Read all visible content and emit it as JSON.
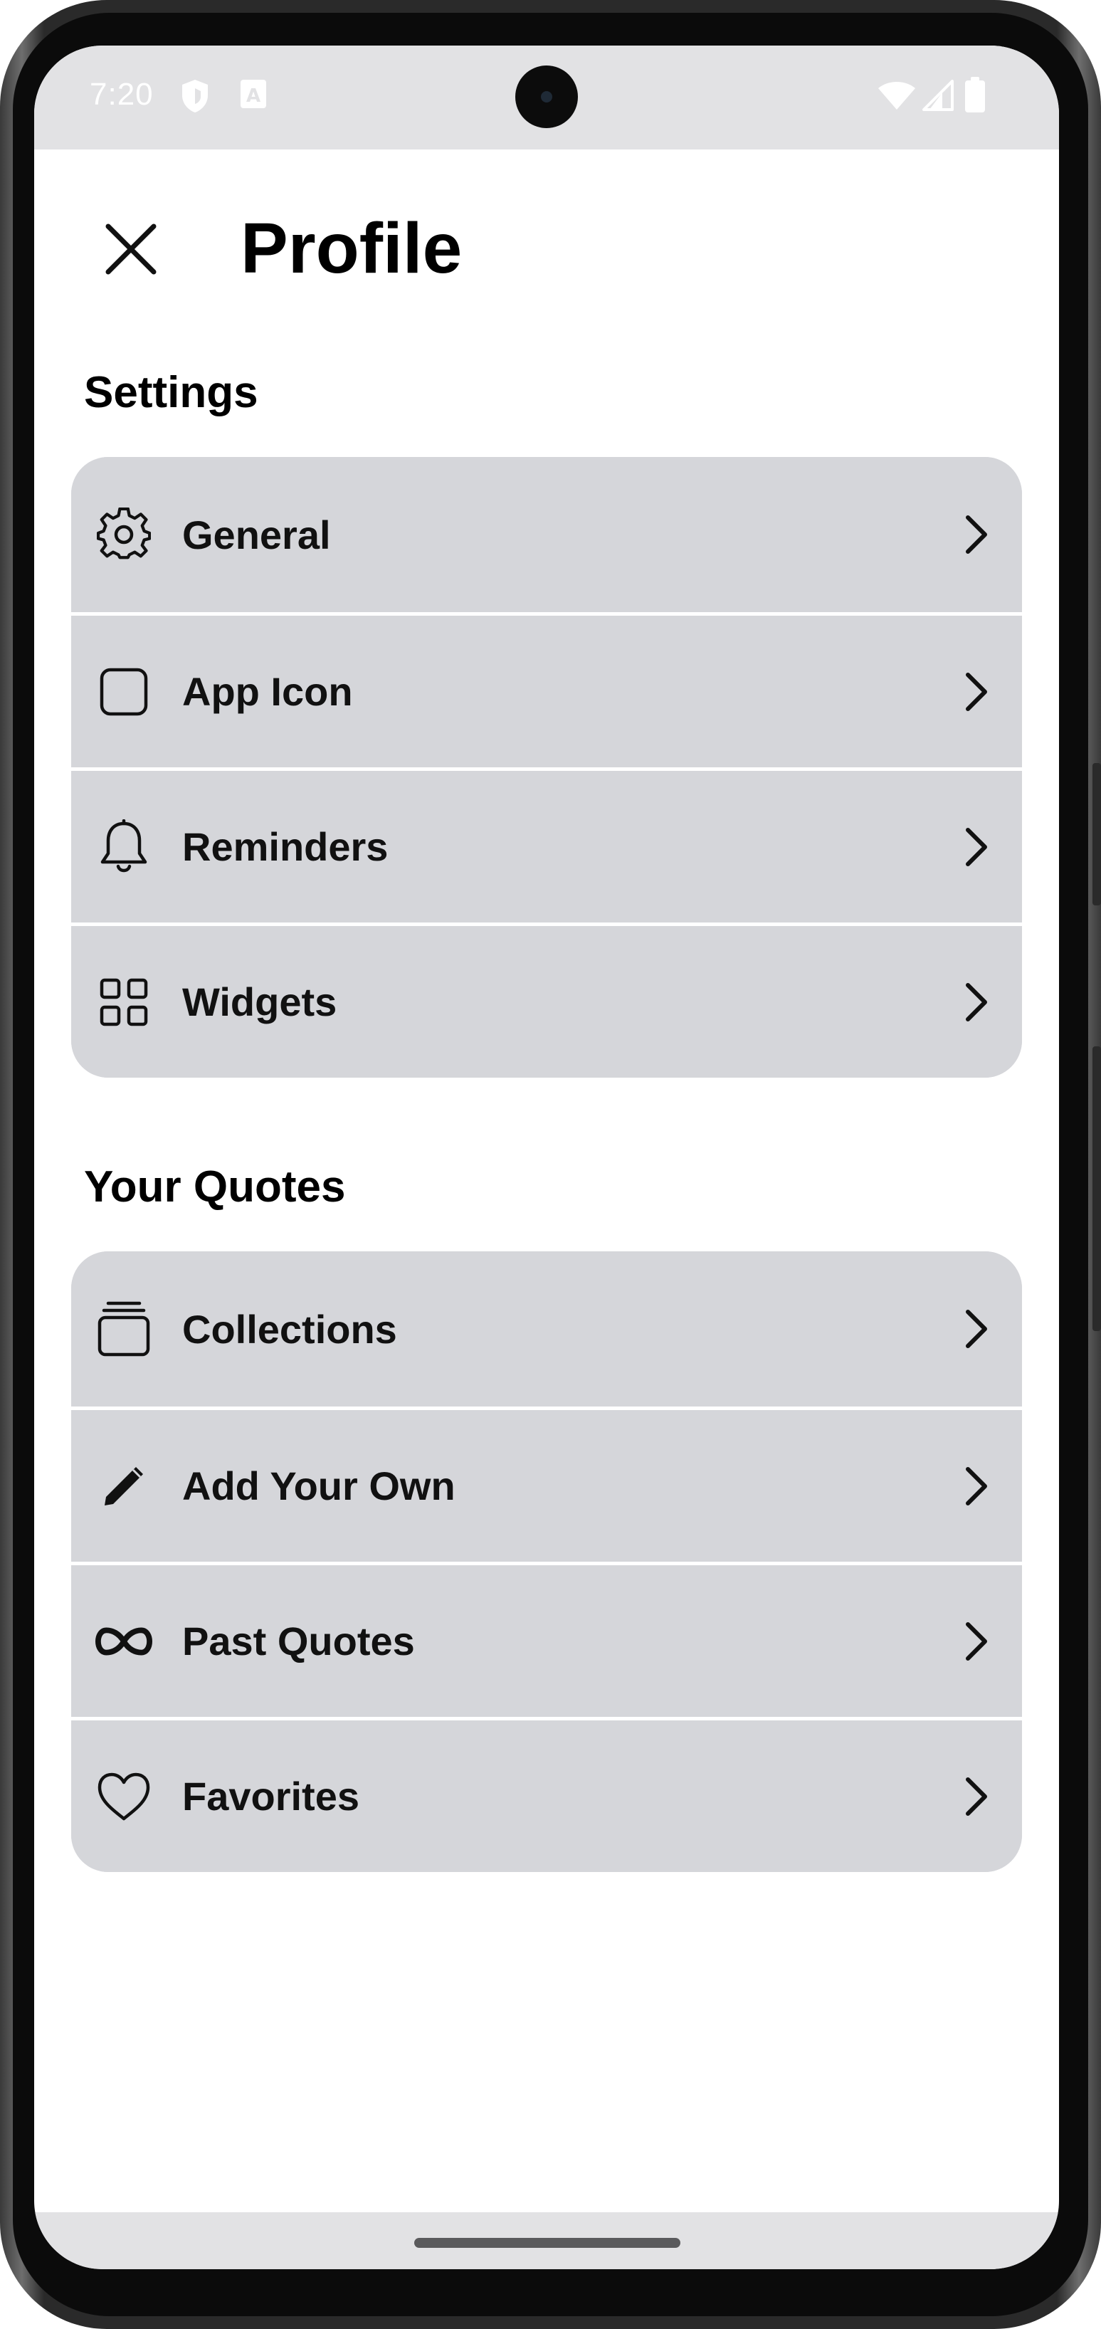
{
  "status_bar": {
    "time": "7:20",
    "icons": [
      "shield-icon",
      "a-box-icon",
      "wifi-icon",
      "cellular-icon",
      "battery-icon"
    ]
  },
  "header": {
    "title": "Profile",
    "close_icon": "close-icon"
  },
  "settings": {
    "title": "Settings",
    "items": [
      {
        "label": "General",
        "icon": "gear-icon"
      },
      {
        "label": "App Icon",
        "icon": "square-icon"
      },
      {
        "label": "Reminders",
        "icon": "bell-icon"
      },
      {
        "label": "Widgets",
        "icon": "grid-icon"
      }
    ]
  },
  "quotes": {
    "title": "Your Quotes",
    "items": [
      {
        "label": "Collections",
        "icon": "stack-icon"
      },
      {
        "label": "Add Your Own",
        "icon": "pencil-icon"
      },
      {
        "label": "Past Quotes",
        "icon": "infinity-icon"
      },
      {
        "label": "Favorites",
        "icon": "heart-icon"
      }
    ]
  },
  "colors": {
    "card_background": "#d5d6da",
    "status_bar": "#e2e2e4",
    "text": "#111111"
  }
}
